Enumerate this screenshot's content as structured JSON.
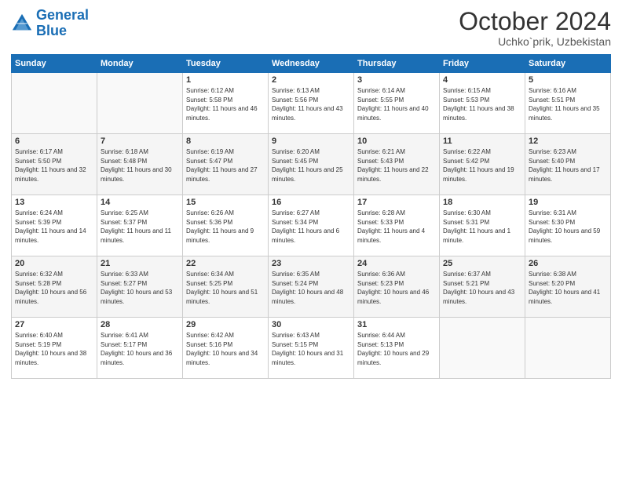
{
  "logo": {
    "line1": "General",
    "line2": "Blue"
  },
  "title": "October 2024",
  "location": "Uchko`prik, Uzbekistan",
  "days_header": [
    "Sunday",
    "Monday",
    "Tuesday",
    "Wednesday",
    "Thursday",
    "Friday",
    "Saturday"
  ],
  "weeks": [
    [
      {
        "day": "",
        "sunrise": "",
        "sunset": "",
        "daylight": ""
      },
      {
        "day": "",
        "sunrise": "",
        "sunset": "",
        "daylight": ""
      },
      {
        "day": "1",
        "sunrise": "Sunrise: 6:12 AM",
        "sunset": "Sunset: 5:58 PM",
        "daylight": "Daylight: 11 hours and 46 minutes."
      },
      {
        "day": "2",
        "sunrise": "Sunrise: 6:13 AM",
        "sunset": "Sunset: 5:56 PM",
        "daylight": "Daylight: 11 hours and 43 minutes."
      },
      {
        "day": "3",
        "sunrise": "Sunrise: 6:14 AM",
        "sunset": "Sunset: 5:55 PM",
        "daylight": "Daylight: 11 hours and 40 minutes."
      },
      {
        "day": "4",
        "sunrise": "Sunrise: 6:15 AM",
        "sunset": "Sunset: 5:53 PM",
        "daylight": "Daylight: 11 hours and 38 minutes."
      },
      {
        "day": "5",
        "sunrise": "Sunrise: 6:16 AM",
        "sunset": "Sunset: 5:51 PM",
        "daylight": "Daylight: 11 hours and 35 minutes."
      }
    ],
    [
      {
        "day": "6",
        "sunrise": "Sunrise: 6:17 AM",
        "sunset": "Sunset: 5:50 PM",
        "daylight": "Daylight: 11 hours and 32 minutes."
      },
      {
        "day": "7",
        "sunrise": "Sunrise: 6:18 AM",
        "sunset": "Sunset: 5:48 PM",
        "daylight": "Daylight: 11 hours and 30 minutes."
      },
      {
        "day": "8",
        "sunrise": "Sunrise: 6:19 AM",
        "sunset": "Sunset: 5:47 PM",
        "daylight": "Daylight: 11 hours and 27 minutes."
      },
      {
        "day": "9",
        "sunrise": "Sunrise: 6:20 AM",
        "sunset": "Sunset: 5:45 PM",
        "daylight": "Daylight: 11 hours and 25 minutes."
      },
      {
        "day": "10",
        "sunrise": "Sunrise: 6:21 AM",
        "sunset": "Sunset: 5:43 PM",
        "daylight": "Daylight: 11 hours and 22 minutes."
      },
      {
        "day": "11",
        "sunrise": "Sunrise: 6:22 AM",
        "sunset": "Sunset: 5:42 PM",
        "daylight": "Daylight: 11 hours and 19 minutes."
      },
      {
        "day": "12",
        "sunrise": "Sunrise: 6:23 AM",
        "sunset": "Sunset: 5:40 PM",
        "daylight": "Daylight: 11 hours and 17 minutes."
      }
    ],
    [
      {
        "day": "13",
        "sunrise": "Sunrise: 6:24 AM",
        "sunset": "Sunset: 5:39 PM",
        "daylight": "Daylight: 11 hours and 14 minutes."
      },
      {
        "day": "14",
        "sunrise": "Sunrise: 6:25 AM",
        "sunset": "Sunset: 5:37 PM",
        "daylight": "Daylight: 11 hours and 11 minutes."
      },
      {
        "day": "15",
        "sunrise": "Sunrise: 6:26 AM",
        "sunset": "Sunset: 5:36 PM",
        "daylight": "Daylight: 11 hours and 9 minutes."
      },
      {
        "day": "16",
        "sunrise": "Sunrise: 6:27 AM",
        "sunset": "Sunset: 5:34 PM",
        "daylight": "Daylight: 11 hours and 6 minutes."
      },
      {
        "day": "17",
        "sunrise": "Sunrise: 6:28 AM",
        "sunset": "Sunset: 5:33 PM",
        "daylight": "Daylight: 11 hours and 4 minutes."
      },
      {
        "day": "18",
        "sunrise": "Sunrise: 6:30 AM",
        "sunset": "Sunset: 5:31 PM",
        "daylight": "Daylight: 11 hours and 1 minute."
      },
      {
        "day": "19",
        "sunrise": "Sunrise: 6:31 AM",
        "sunset": "Sunset: 5:30 PM",
        "daylight": "Daylight: 10 hours and 59 minutes."
      }
    ],
    [
      {
        "day": "20",
        "sunrise": "Sunrise: 6:32 AM",
        "sunset": "Sunset: 5:28 PM",
        "daylight": "Daylight: 10 hours and 56 minutes."
      },
      {
        "day": "21",
        "sunrise": "Sunrise: 6:33 AM",
        "sunset": "Sunset: 5:27 PM",
        "daylight": "Daylight: 10 hours and 53 minutes."
      },
      {
        "day": "22",
        "sunrise": "Sunrise: 6:34 AM",
        "sunset": "Sunset: 5:25 PM",
        "daylight": "Daylight: 10 hours and 51 minutes."
      },
      {
        "day": "23",
        "sunrise": "Sunrise: 6:35 AM",
        "sunset": "Sunset: 5:24 PM",
        "daylight": "Daylight: 10 hours and 48 minutes."
      },
      {
        "day": "24",
        "sunrise": "Sunrise: 6:36 AM",
        "sunset": "Sunset: 5:23 PM",
        "daylight": "Daylight: 10 hours and 46 minutes."
      },
      {
        "day": "25",
        "sunrise": "Sunrise: 6:37 AM",
        "sunset": "Sunset: 5:21 PM",
        "daylight": "Daylight: 10 hours and 43 minutes."
      },
      {
        "day": "26",
        "sunrise": "Sunrise: 6:38 AM",
        "sunset": "Sunset: 5:20 PM",
        "daylight": "Daylight: 10 hours and 41 minutes."
      }
    ],
    [
      {
        "day": "27",
        "sunrise": "Sunrise: 6:40 AM",
        "sunset": "Sunset: 5:19 PM",
        "daylight": "Daylight: 10 hours and 38 minutes."
      },
      {
        "day": "28",
        "sunrise": "Sunrise: 6:41 AM",
        "sunset": "Sunset: 5:17 PM",
        "daylight": "Daylight: 10 hours and 36 minutes."
      },
      {
        "day": "29",
        "sunrise": "Sunrise: 6:42 AM",
        "sunset": "Sunset: 5:16 PM",
        "daylight": "Daylight: 10 hours and 34 minutes."
      },
      {
        "day": "30",
        "sunrise": "Sunrise: 6:43 AM",
        "sunset": "Sunset: 5:15 PM",
        "daylight": "Daylight: 10 hours and 31 minutes."
      },
      {
        "day": "31",
        "sunrise": "Sunrise: 6:44 AM",
        "sunset": "Sunset: 5:13 PM",
        "daylight": "Daylight: 10 hours and 29 minutes."
      },
      {
        "day": "",
        "sunrise": "",
        "sunset": "",
        "daylight": ""
      },
      {
        "day": "",
        "sunrise": "",
        "sunset": "",
        "daylight": ""
      }
    ]
  ]
}
